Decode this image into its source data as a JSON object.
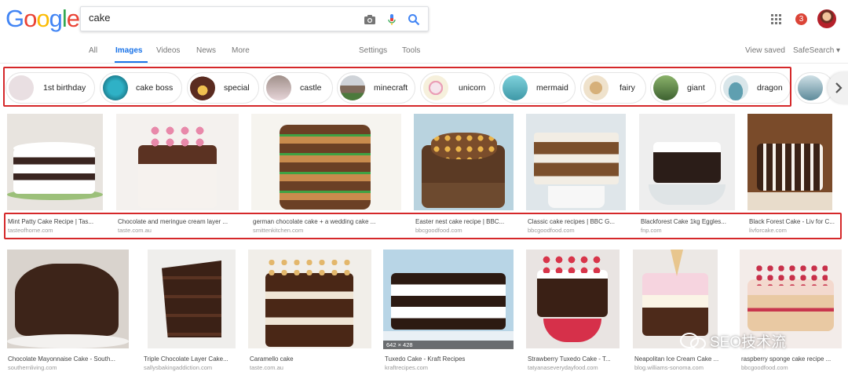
{
  "logo": {
    "letters": [
      "G",
      "o",
      "o",
      "g",
      "l",
      "e"
    ],
    "colors": [
      "#4285F4",
      "#EA4335",
      "#FBBC05",
      "#4285F4",
      "#34A853",
      "#EA4335"
    ]
  },
  "search": {
    "value": "cake"
  },
  "header": {
    "notifications": "3"
  },
  "tabs": {
    "all": "All",
    "images": "Images",
    "videos": "Videos",
    "news": "News",
    "more": "More",
    "settings": "Settings",
    "tools": "Tools",
    "view_saved": "View saved",
    "safesearch": "SafeSearch ▾"
  },
  "chips": [
    {
      "label": "1st birthday",
      "color": "#e9dfe2"
    },
    {
      "label": "cake boss",
      "color": "#1c8fa5"
    },
    {
      "label": "special",
      "color": "#5a2b20"
    },
    {
      "label": "castle",
      "color": "#c7a7b0"
    },
    {
      "label": "minecraft",
      "color": "#7f6a5a"
    },
    {
      "label": "unicorn",
      "color": "#f3e7dc"
    },
    {
      "label": "mermaid",
      "color": "#5fb8c4"
    },
    {
      "label": "fairy",
      "color": "#e6d3b6"
    },
    {
      "label": "giant",
      "color": "#4e7a3d"
    },
    {
      "label": "dragon",
      "color": "#5f9fb0"
    }
  ],
  "row1": [
    {
      "title": "Mint Patty Cake Recipe | Tas...",
      "domain": "tasteofhome.com",
      "bg": "#e8e4df",
      "cake": "#3a2520"
    },
    {
      "title": "Chocolate and meringue cream layer ...",
      "domain": "taste.com.au",
      "bg": "#f4f1ee",
      "cake": "#5b3222"
    },
    {
      "title": "german chocolate cake + a wedding cake ...",
      "domain": "smittenkitchen.com",
      "bg": "#f6f4ef",
      "cake": "#6b4025"
    },
    {
      "title": "Easter nest cake recipe | BBC...",
      "domain": "bbcgoodfood.com",
      "bg": "#b9d3df",
      "cake": "#5b3a24"
    },
    {
      "title": "Classic cake recipes | BBC G...",
      "domain": "bbcgoodfood.com",
      "bg": "#dfe6ea",
      "cake": "#7b4f2c"
    },
    {
      "title": "Blackforest Cake 1kg Eggles...",
      "domain": "fnp.com",
      "bg": "#eeeeee",
      "cake": "#2b1d18"
    },
    {
      "title": "Black Forest Cake - Liv for C...",
      "domain": "livforcake.com",
      "bg": "#7a4b2a",
      "cake": "#3b2216"
    }
  ],
  "row2": [
    {
      "title": "Chocolate Mayonnaise Cake - South...",
      "domain": "southernliving.com",
      "bg": "#d9d3cd",
      "cake": "#3d2419"
    },
    {
      "title": "Triple Chocolate Layer Cake...",
      "domain": "sallysbakingaddiction.com",
      "bg": "#efeeec",
      "cake": "#3b2116"
    },
    {
      "title": "Caramello cake",
      "domain": "taste.com.au",
      "bg": "#f1eee9",
      "cake": "#4a2716"
    },
    {
      "title": "Tuxedo Cake - Kraft Recipes",
      "domain": "kraftrecipes.com",
      "bg": "#b8d5e6",
      "cake": "#2c1a12"
    },
    {
      "title": "Strawberry Tuxedo Cake - T...",
      "domain": "tatyanaseverydayfood.com",
      "bg": "#e9e4e2",
      "cake": "#3a2015"
    },
    {
      "title": "Neapolitan Ice Cream Cake ...",
      "domain": "blog.williams-sonoma.com",
      "bg": "#ece8e5",
      "cake": "#4d2a1a"
    },
    {
      "title": "raspberry sponge cake recipe ...",
      "domain": "bbcgoodfood.com",
      "bg": "#f3ece9",
      "cake": "#e9c9a3"
    }
  ],
  "overlay": {
    "dims": "642 × 428",
    "watermark": "SEO技术流"
  }
}
